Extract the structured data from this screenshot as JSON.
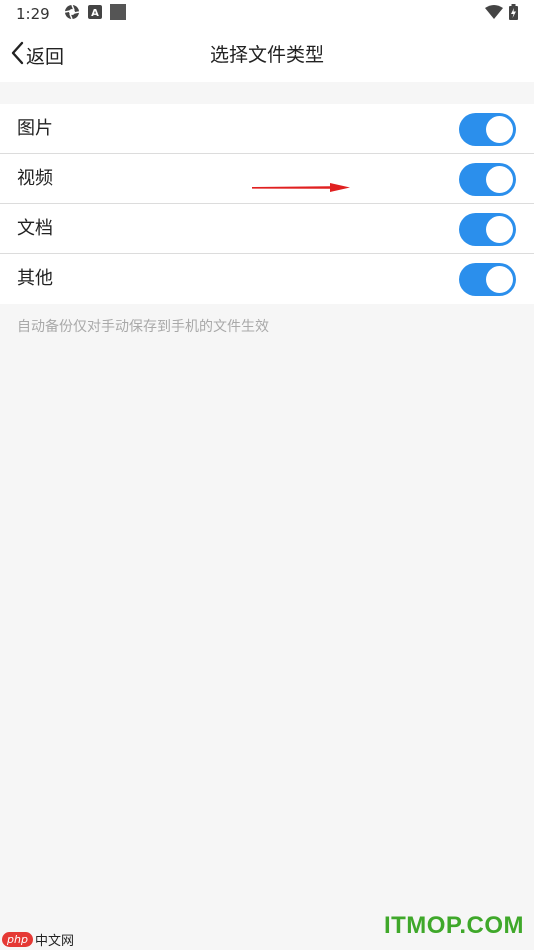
{
  "status_bar": {
    "time": "1:29",
    "icons": [
      "aperture-icon",
      "a-box-icon",
      "square-icon",
      "wifi-icon",
      "battery-charging-icon"
    ]
  },
  "header": {
    "back_label": "返回",
    "title": "选择文件类型"
  },
  "file_types": [
    {
      "label": "图片",
      "enabled": true
    },
    {
      "label": "视频",
      "enabled": true
    },
    {
      "label": "文档",
      "enabled": true
    },
    {
      "label": "其他",
      "enabled": true
    }
  ],
  "note": "自动备份仅对手动保存到手机的文件生效",
  "colors": {
    "toggle_on": "#2b8fec",
    "annotation_arrow": "#e02020"
  },
  "watermarks": {
    "php_badge": "php",
    "php_site": "中文网",
    "itmop": "ITMOP.COM"
  }
}
